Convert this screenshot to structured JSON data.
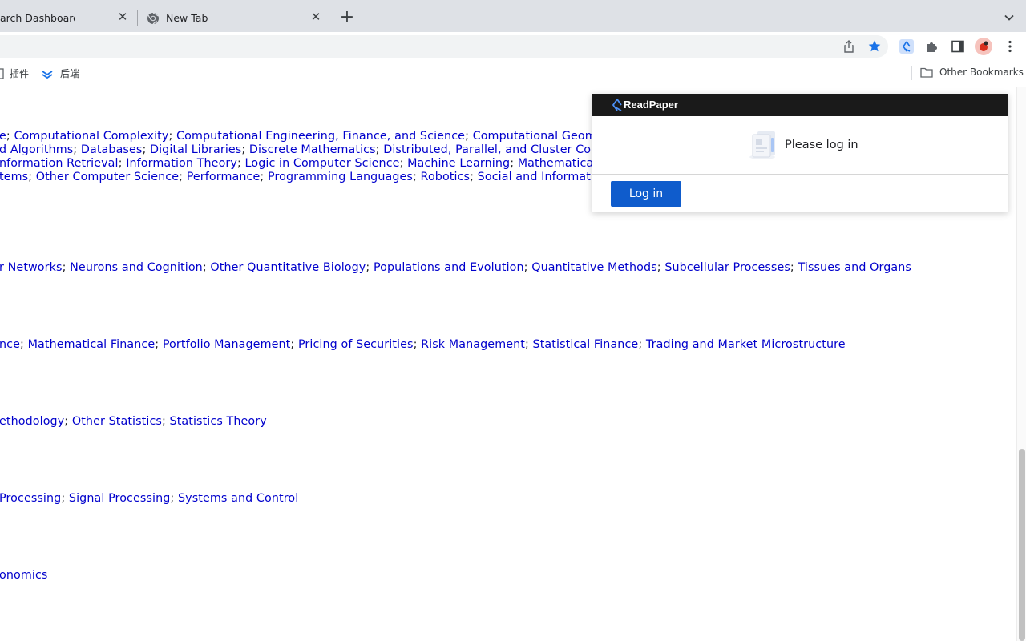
{
  "browser": {
    "tabs": [
      {
        "title": "arch Dashboard | S",
        "close": "✕"
      },
      {
        "title": "New Tab",
        "close": "✕"
      }
    ],
    "new_tab": "+",
    "bookmarks": [
      {
        "label": "插件",
        "icon": "grid-icon"
      },
      {
        "label": "后端",
        "icon": "layers-icon"
      }
    ],
    "other_bookmarks": "Other Bookmarks"
  },
  "content": {
    "lines": [
      {
        "items": [
          "e",
          "Computational Complexity",
          "Computational Engineering, Finance, and Science",
          "Computational Geometry"
        ]
      },
      {
        "items": [
          "d Algorithms",
          "Databases",
          "Digital Libraries",
          "Discrete Mathematics",
          "Distributed, Parallel, and Cluster Compu"
        ]
      },
      {
        "items": [
          "nformation Retrieval",
          "Information Theory",
          "Logic in Computer Science",
          "Machine Learning",
          "Mathematical So"
        ]
      },
      {
        "items": [
          "tems",
          "Other Computer Science",
          "Performance",
          "Programming Languages",
          "Robotics",
          "Social and Information N"
        ]
      },
      {
        "items": [
          "r Networks",
          "Neurons and Cognition",
          "Other Quantitative Biology",
          "Populations and Evolution",
          "Quantitative Methods",
          "Subcellular Processes",
          "Tissues and Organs"
        ]
      },
      {
        "items": [
          "nce",
          "Mathematical Finance",
          "Portfolio Management",
          "Pricing of Securities",
          "Risk Management",
          "Statistical Finance",
          "Trading and Market Microstructure"
        ]
      },
      {
        "items": [
          "ethodology",
          "Other Statistics",
          "Statistics Theory"
        ]
      },
      {
        "items": [
          "Processing",
          "Signal Processing",
          "Systems and Control"
        ]
      },
      {
        "items": [
          "onomics"
        ]
      }
    ]
  },
  "popup": {
    "brand": "ReadPaper",
    "message": "Please log in",
    "login_button": "Log in",
    "header_color": "#1a1a1a",
    "button_color": "#0f5ccc"
  }
}
